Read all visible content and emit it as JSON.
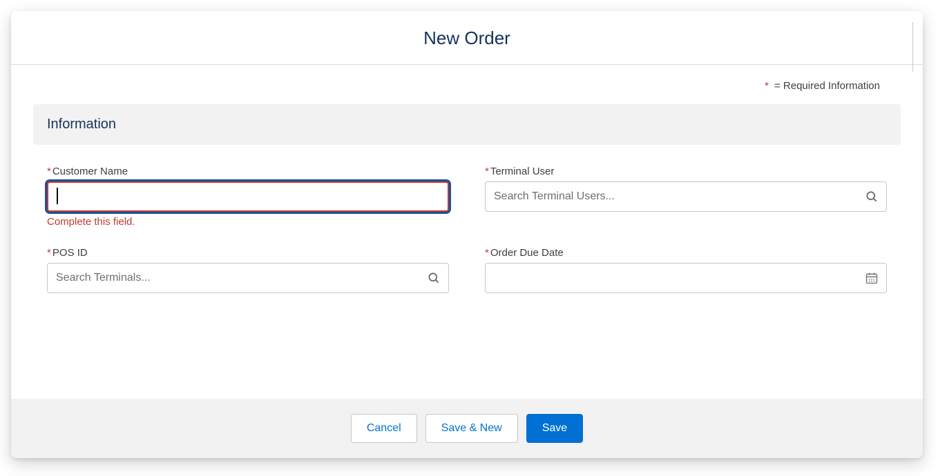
{
  "modal": {
    "title": "New Order",
    "required_note": "= Required Information",
    "section_title": "Information"
  },
  "fields": {
    "customer_name": {
      "label": "Customer Name",
      "value": "",
      "error": "Complete this field."
    },
    "terminal_user": {
      "label": "Terminal User",
      "placeholder": "Search Terminal Users..."
    },
    "pos_id": {
      "label": "POS ID",
      "placeholder": "Search Terminals..."
    },
    "order_due_date": {
      "label": "Order Due Date"
    }
  },
  "buttons": {
    "cancel": "Cancel",
    "save_new": "Save & New",
    "save": "Save"
  }
}
